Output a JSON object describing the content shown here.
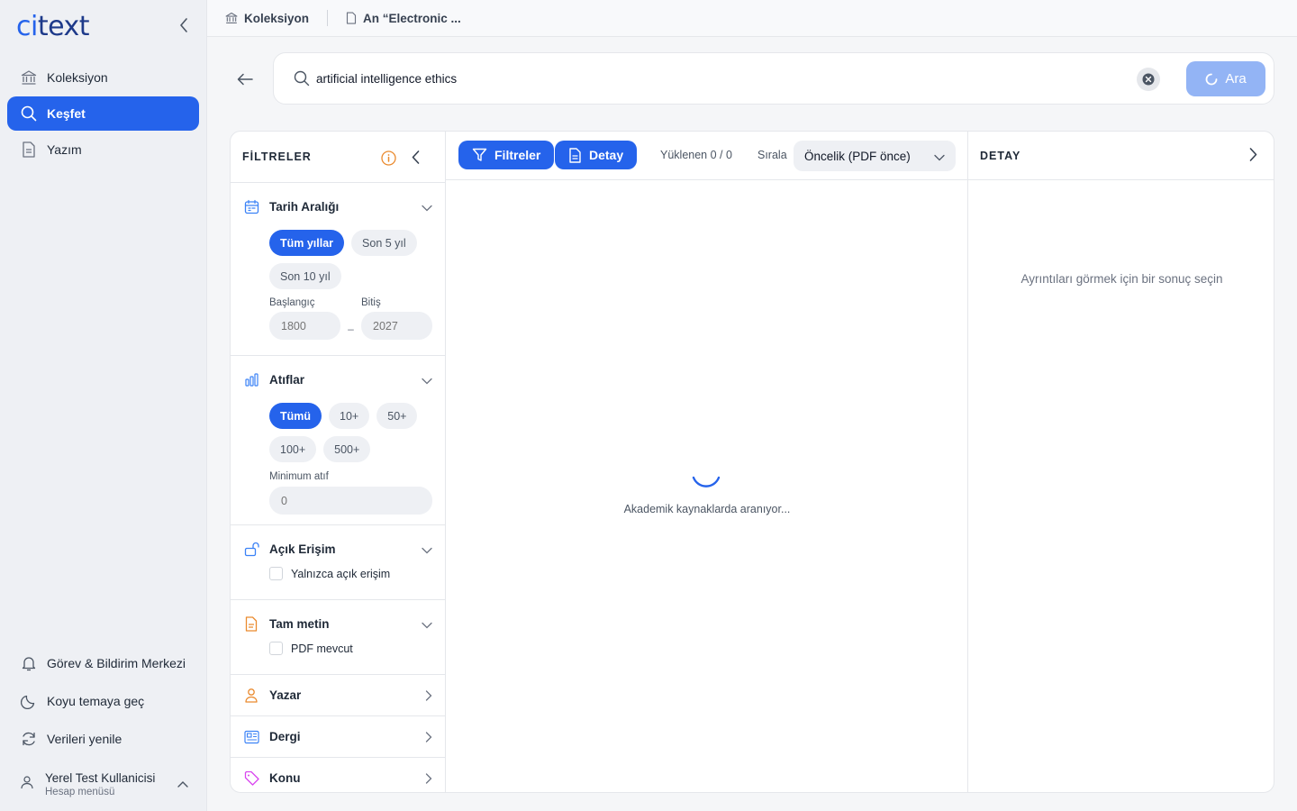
{
  "app": {
    "logo_prefix": "ci",
    "logo_suffix": "text"
  },
  "sidebar": {
    "items": [
      {
        "label": "Koleksiyon",
        "icon": "bank-icon",
        "active": false
      },
      {
        "label": "Keşfet",
        "icon": "search-icon",
        "active": true
      },
      {
        "label": "Yazım",
        "icon": "document-icon",
        "active": false
      }
    ],
    "bottom": [
      {
        "label": "Görev & Bildirim Merkezi",
        "icon": "bell-icon"
      },
      {
        "label": "Koyu temaya geç",
        "icon": "moon-icon"
      },
      {
        "label": "Verileri yenile",
        "icon": "refresh-icon"
      }
    ],
    "user": {
      "name": "Yerel Test Kullanicisi",
      "menu": "Hesap menüsü"
    }
  },
  "topbar": {
    "crumbs": [
      "Koleksiyon",
      "An “Electronic ..."
    ]
  },
  "search": {
    "query": "artificial intelligence ethics",
    "button": "Ara"
  },
  "filters": {
    "title": "FİLTRELER",
    "date": {
      "label": "Tarih Aralığı",
      "chips": [
        "Tüm yıllar",
        "Son 5 yıl",
        "Son 10 yıl"
      ],
      "start_label": "Başlangıç",
      "end_label": "Bitiş",
      "start_placeholder": "1800",
      "end_placeholder": "2027",
      "dash": "–"
    },
    "citations": {
      "label": "Atıflar",
      "chips": [
        "Tümü",
        "10+",
        "50+",
        "100+",
        "500+"
      ],
      "min_label": "Minimum atıf",
      "min_placeholder": "0"
    },
    "open_access": {
      "label": "Açık Erişim",
      "option": "Yalnızca açık erişim"
    },
    "fulltext": {
      "label": "Tam metin",
      "option": "PDF mevcut"
    },
    "author": {
      "label": "Yazar"
    },
    "journal": {
      "label": "Dergi"
    },
    "topic": {
      "label": "Konu"
    }
  },
  "results": {
    "filters_button": "Filtreler",
    "detail_button": "Detay",
    "loaded": "Yüklenen 0 / 0",
    "sort_label": "Sırala",
    "sort_value": "Öncelik (PDF önce)",
    "loading": "Akademik kaynaklarda aranıyor..."
  },
  "detail": {
    "title": "DETAY",
    "empty": "Ayrıntıları görmek için bir sonuç seçin"
  },
  "colors": {
    "accent": "#2563eb",
    "accent_light": "#93b4f5",
    "sidebar_bg": "#eef0f4"
  }
}
